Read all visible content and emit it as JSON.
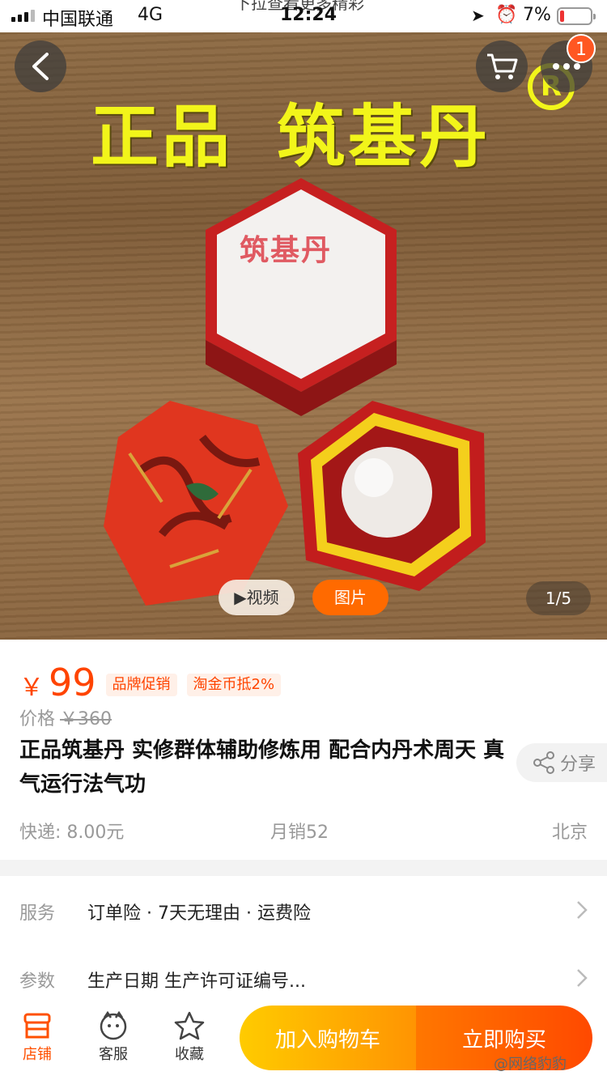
{
  "status_bar": {
    "carrier": "中国联通",
    "network": "4G",
    "pull_hint": "下拉查看更多精彩",
    "time": "12:24",
    "battery": "7%"
  },
  "hero": {
    "headline_left": "正品",
    "headline_right": "筑基丹",
    "reg_mark": "R",
    "lid_label": "筑基丹",
    "cart_badge": "1",
    "video_label": "▶视频",
    "photo_label": "图片",
    "page_indicator": "1/5"
  },
  "product": {
    "currency": "￥",
    "price": "99",
    "tags": [
      "品牌促销",
      "淘金币抵2%"
    ],
    "orig_label": "价格",
    "orig_price": "￥360",
    "title": "正品筑基丹 实修群体辅助修炼用 配合内丹术周天 真气运行法气功",
    "share_label": "分享",
    "shipping": "快递: 8.00元",
    "monthly_sales": "月销52",
    "location": "北京"
  },
  "details": {
    "service_label": "服务",
    "service_value": "订单险 · 7天无理由 · 运费险",
    "params_label": "参数",
    "params_value": "生产日期 生产许可证编号..."
  },
  "bottom_bar": {
    "store_label": "店铺",
    "service_label": "客服",
    "fav_label": "收藏",
    "add_cart_label": "加入购物车",
    "buy_now_label": "立即购买"
  },
  "watermark": "@网络豹豹",
  "colors": {
    "accent": "#ff4400",
    "cart_gradient": [
      "#ffcb00",
      "#ff9402"
    ],
    "buy_gradient": [
      "#ff7700",
      "#ff4900"
    ],
    "headline": "#f2f51a"
  }
}
